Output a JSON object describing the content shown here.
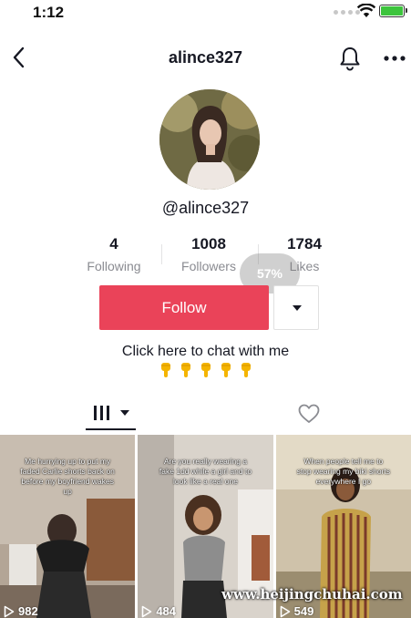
{
  "status_bar": {
    "time": "1:12"
  },
  "nav": {
    "title": "alince327"
  },
  "profile": {
    "handle": "@alince327",
    "stats": [
      {
        "value": "4",
        "label": "Following"
      },
      {
        "value": "1008",
        "label": "Followers"
      },
      {
        "value": "1784",
        "label": "Likes"
      }
    ],
    "overlay_percent": "57%",
    "follow_label": "Follow",
    "bio": "Click here to chat with me",
    "bio_emoji_count": 5
  },
  "videos": [
    {
      "caption": "Me hurrying up to put my faded Carlie shorts back on before my boyfriend wakes up",
      "views": "982"
    },
    {
      "caption": "Are you really wearing a fake 1dd while a girl and to look like a real one",
      "views": "484"
    },
    {
      "caption": "When people tell me to stop wearing my biki shorts everywhere I go",
      "views": "549"
    }
  ],
  "watermark": "www.heijingchuhai.com",
  "colors": {
    "accent": "#ea4359",
    "text": "#161823",
    "muted": "#8a8b91",
    "battery": "#3cc43c"
  }
}
